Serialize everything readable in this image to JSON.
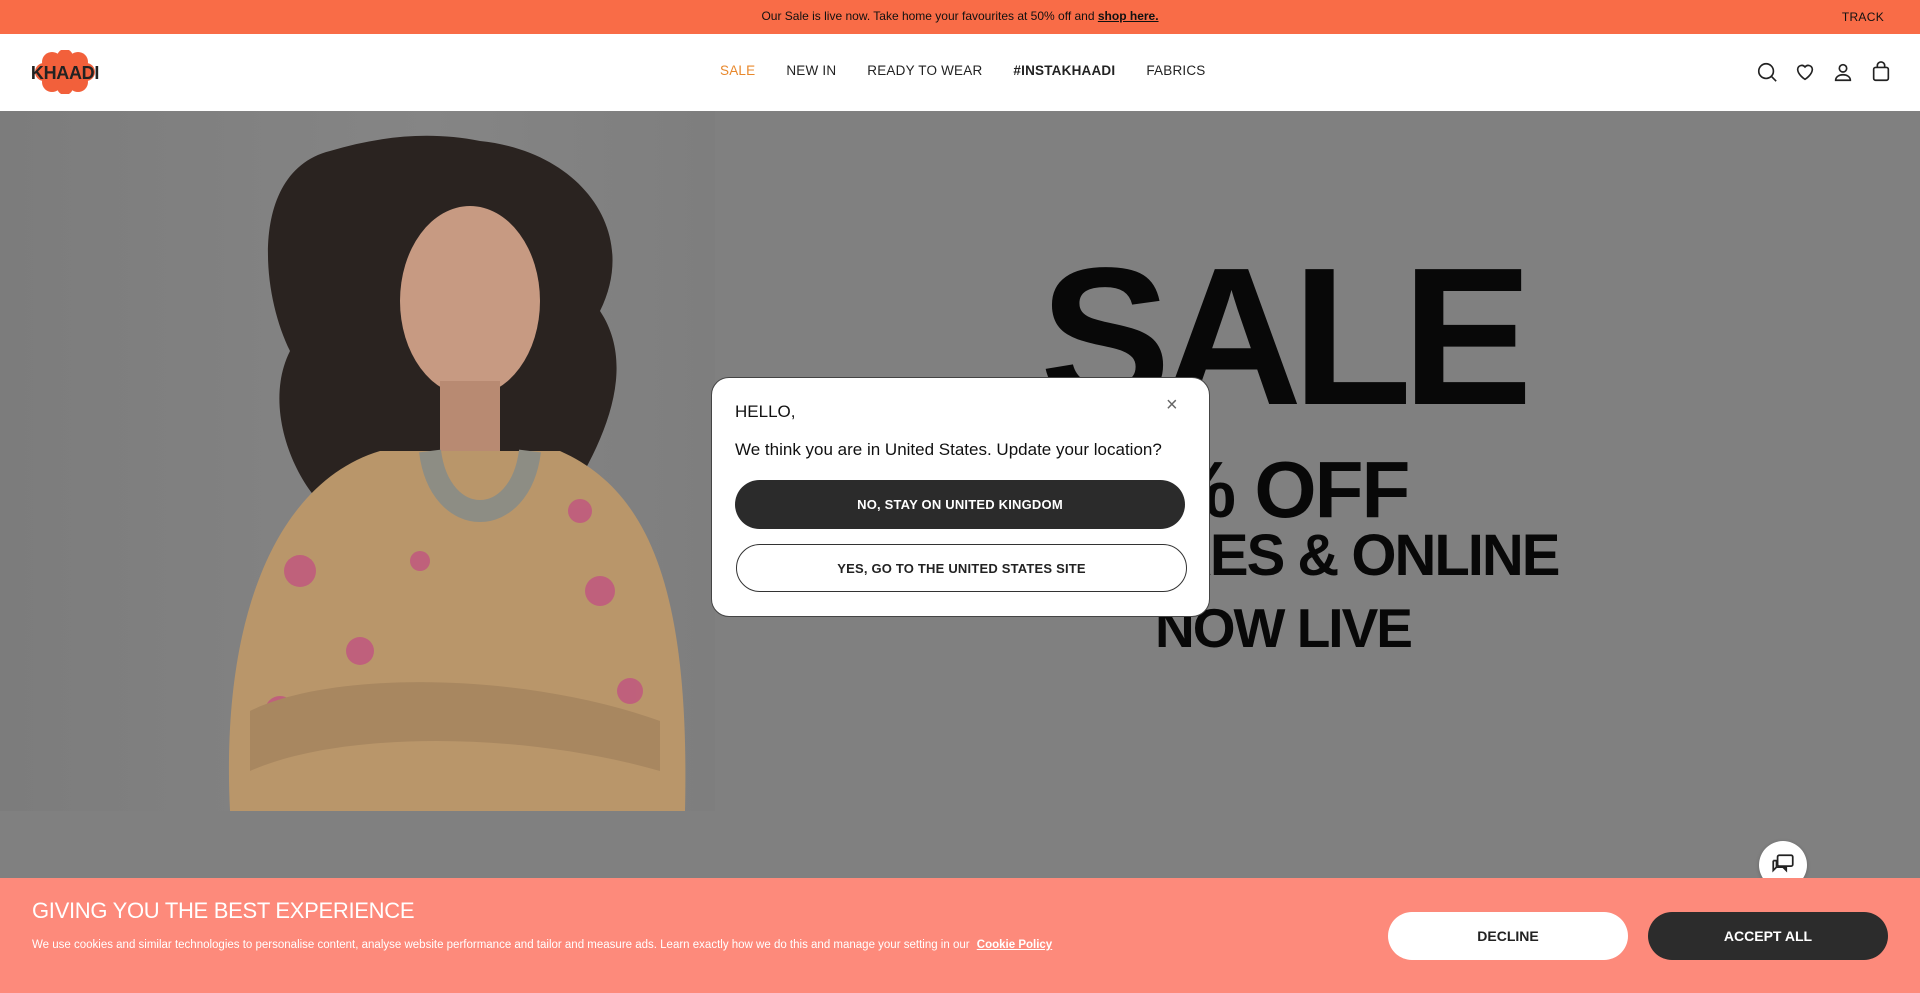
{
  "announcement": {
    "message": "Our Sale is live now. Take home your favourites at 50% off and",
    "link": "shop here.",
    "track": "TRACK"
  },
  "header": {
    "logo_text": "KHAADI",
    "nav": [
      "SALE",
      "NEW IN",
      "READY TO WEAR",
      "#INSTAKHAADI",
      "FABRICS"
    ],
    "icons": [
      "search-icon",
      "heart-icon",
      "user-icon",
      "bag-icon"
    ]
  },
  "hero": {
    "line1": "SALE",
    "line2": "% OFF",
    "line3": "RES & ONLINE",
    "line4": "NOW LIVE"
  },
  "modal": {
    "greeting": "HELLO,",
    "question": "We think you are in United States. Update your location?",
    "stay_button": "NO, STAY ON UNITED KINGDOM",
    "go_button": "YES, GO TO THE UNITED STATES SITE",
    "close": "×"
  },
  "cookie": {
    "heading": "GIVING YOU THE BEST EXPERIENCE",
    "text": "We use cookies and similar technologies to personalise content, analyse website performance and tailor and measure ads. Learn exactly how we do this and manage your setting in our",
    "policy_link": "Cookie Policy",
    "decline": "DECLINE",
    "accept": "ACCEPT ALL"
  },
  "colors": {
    "announce_bg": "#f96c47",
    "cookie_bg": "#fd8a7b",
    "nav_sale": "#e8882c",
    "dark_button": "#2b2b2b",
    "overlay": "#808080"
  }
}
